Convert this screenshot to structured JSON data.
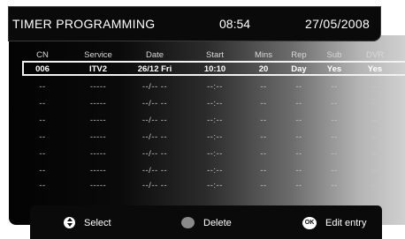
{
  "header": {
    "title": "TIMER PROGRAMMING",
    "time": "08:54",
    "date": "27/05/2008"
  },
  "columns": {
    "cn": "CN",
    "service": "Service",
    "date": "Date",
    "start": "Start",
    "mins": "Mins",
    "rep": "Rep",
    "sub": "Sub",
    "dvr": "DVR"
  },
  "rows": [
    {
      "cn": "006",
      "service": "ITV2",
      "date": "26/12 Fri",
      "start": "10:10",
      "mins": "20",
      "rep": "Day",
      "sub": "Yes",
      "dvr": "Yes"
    },
    {
      "cn": "--",
      "service": "-----",
      "date": "--/-- --",
      "start": "--:--",
      "mins": "--",
      "rep": "--",
      "sub": "--",
      "dvr": "--"
    },
    {
      "cn": "--",
      "service": "-----",
      "date": "--/-- --",
      "start": "--:--",
      "mins": "--",
      "rep": "--",
      "sub": "--",
      "dvr": "--"
    },
    {
      "cn": "--",
      "service": "-----",
      "date": "--/-- --",
      "start": "--:--",
      "mins": "--",
      "rep": "--",
      "sub": "--",
      "dvr": "--"
    },
    {
      "cn": "--",
      "service": "-----",
      "date": "--/-- --",
      "start": "--:--",
      "mins": "--",
      "rep": "--",
      "sub": "--",
      "dvr": "--"
    },
    {
      "cn": "--",
      "service": "-----",
      "date": "--/-- --",
      "start": "--:--",
      "mins": "--",
      "rep": "--",
      "sub": "--",
      "dvr": "--"
    },
    {
      "cn": "--",
      "service": "-----",
      "date": "--/-- --",
      "start": "--:--",
      "mins": "--",
      "rep": "--",
      "sub": "--",
      "dvr": "--"
    },
    {
      "cn": "--",
      "service": "-----",
      "date": "--/-- --",
      "start": "--:--",
      "mins": "--",
      "rep": "--",
      "sub": "--",
      "dvr": "--"
    }
  ],
  "footer": {
    "select_label": "Select",
    "delete_label": "Delete",
    "edit_label": "Edit entry",
    "ok_glyph": "OK",
    "select_icon": "up-down-arrow-icon",
    "delete_icon": "grey-button-icon",
    "ok_icon": "ok-button-icon"
  },
  "colors": {
    "panel_dark": "#0a0a0a",
    "text": "#ffffff"
  }
}
